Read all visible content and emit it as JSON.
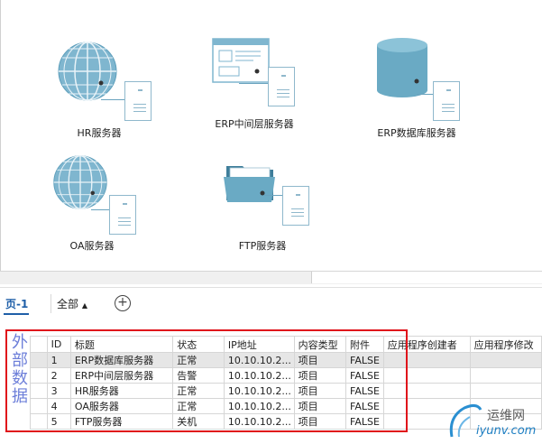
{
  "canvas": {
    "shapes": [
      {
        "name": "hr-server",
        "label": "HR服务器",
        "kind": "globe"
      },
      {
        "name": "erp-middle-server",
        "label": "ERP中间层服务器",
        "kind": "web"
      },
      {
        "name": "erp-db-server",
        "label": "ERP数据库服务器",
        "kind": "database"
      },
      {
        "name": "oa-server",
        "label": "OA服务器",
        "kind": "globe"
      },
      {
        "name": "ftp-server",
        "label": "FTP服务器",
        "kind": "folder"
      }
    ]
  },
  "pagebar": {
    "current_page": "页-1",
    "all_pages": "全部",
    "add_page_symbol": "+"
  },
  "external_data": {
    "vertical_label": "外部数据",
    "columns": [
      "ID",
      "标题",
      "状态",
      "IP地址",
      "内容类型",
      "附件",
      "应用程序创建者",
      "应用程序修改"
    ],
    "rows": [
      {
        "id": "1",
        "title": "ERP数据库服务器",
        "status": "正常",
        "ip": "10.10.10.2...",
        "type": "项目",
        "attach": "FALSE",
        "creator": "",
        "modifier": ""
      },
      {
        "id": "2",
        "title": "ERP中间层服务器",
        "status": "告警",
        "ip": "10.10.10.2...",
        "type": "项目",
        "attach": "FALSE",
        "creator": "",
        "modifier": ""
      },
      {
        "id": "3",
        "title": "HR服务器",
        "status": "正常",
        "ip": "10.10.10.2...",
        "type": "项目",
        "attach": "FALSE",
        "creator": "",
        "modifier": ""
      },
      {
        "id": "4",
        "title": "OA服务器",
        "status": "正常",
        "ip": "10.10.10.2...",
        "type": "项目",
        "attach": "FALSE",
        "creator": "",
        "modifier": ""
      },
      {
        "id": "5",
        "title": "FTP服务器",
        "status": "关机",
        "ip": "10.10.10.2...",
        "type": "项目",
        "attach": "FALSE",
        "creator": "",
        "modifier": ""
      }
    ]
  },
  "watermark": {
    "cn": "运维网",
    "en": "iyunv.com"
  },
  "colors": {
    "accent": "#1f5fa8",
    "highlight": "#e0141b",
    "shape_blue": "#5ea7c2"
  }
}
